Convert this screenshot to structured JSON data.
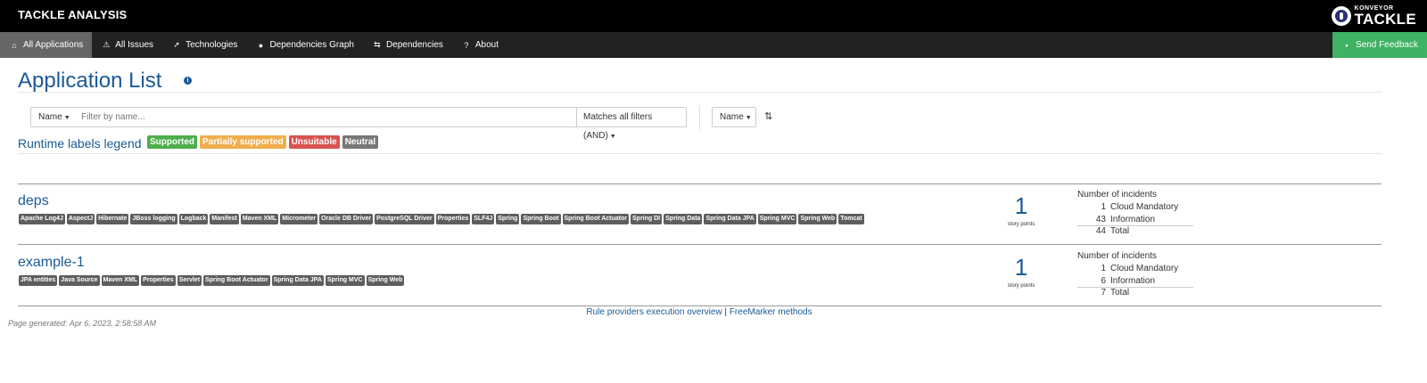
{
  "header": {
    "title": "TACKLE ANALYSIS",
    "logo_small": "KONVEYOR",
    "logo_big": "TACKLE"
  },
  "nav": {
    "items": [
      {
        "label": "All Applications",
        "icon": "home-icon",
        "glyph": "⌂",
        "active": true
      },
      {
        "label": "All Issues",
        "icon": "warning-icon",
        "glyph": "⚠",
        "active": false
      },
      {
        "label": "Technologies",
        "icon": "rocket-icon",
        "glyph": "➚",
        "active": false
      },
      {
        "label": "Dependencies Graph",
        "icon": "pin-icon",
        "glyph": "●",
        "active": false
      },
      {
        "label": "Dependencies",
        "icon": "transfer-icon",
        "glyph": "⇆",
        "active": false
      },
      {
        "label": "About",
        "icon": "question-icon",
        "glyph": "?",
        "active": false
      }
    ],
    "feedback": {
      "label": "Send Feedback",
      "icon": "comment-icon",
      "glyph": "▪"
    }
  },
  "page": {
    "title": "Application List"
  },
  "toolbar": {
    "filter_field": "Name",
    "filter_placeholder": "Filter by name...",
    "match_mode": "Matches all filters (AND)",
    "sort_field": "Name"
  },
  "legend": {
    "label": "Runtime labels legend",
    "badges": [
      {
        "label": "Supported",
        "color": "#4cae4c"
      },
      {
        "label": "Partially supported",
        "color": "#f0ad4e"
      },
      {
        "label": "Unsuitable",
        "color": "#d9534f"
      },
      {
        "label": "Neutral",
        "color": "#777777"
      }
    ]
  },
  "applications": [
    {
      "name": "deps",
      "tags": [
        "Apache Log4J",
        "AspectJ",
        "Hibernate",
        "JBoss logging",
        "Logback",
        "Manifest",
        "Maven XML",
        "Micrometer",
        "Oracle DB Driver",
        "PostgreSQL Driver",
        "Properties",
        "SLF4J",
        "Spring",
        "Spring Boot",
        "Spring Boot Actuator",
        "Spring DI",
        "Spring Data",
        "Spring Data JPA",
        "Spring MVC",
        "Spring Web",
        "Tomcat"
      ],
      "story_points": "1",
      "story_points_label": "story points",
      "incidents_title": "Number of incidents",
      "incidents": [
        {
          "count": "1",
          "label": "Cloud Mandatory"
        },
        {
          "count": "43",
          "label": "Information"
        }
      ],
      "total": {
        "count": "44",
        "label": "Total"
      }
    },
    {
      "name": "example-1",
      "tags": [
        "JPA entities",
        "Java Source",
        "Maven XML",
        "Properties",
        "Servlet",
        "Spring Boot Actuator",
        "Spring Data JPA",
        "Spring MVC",
        "Spring Web"
      ],
      "story_points": "1",
      "story_points_label": "story points",
      "incidents_title": "Number of incidents",
      "incidents": [
        {
          "count": "1",
          "label": "Cloud Mandatory"
        },
        {
          "count": "6",
          "label": "Information"
        }
      ],
      "total": {
        "count": "7",
        "label": "Total"
      }
    }
  ],
  "footer": {
    "link1": "Rule providers execution overview",
    "separator": " | ",
    "link2": "FreeMarker methods",
    "generated": "Page generated: Apr 6, 2023, 2:58:58 AM"
  }
}
